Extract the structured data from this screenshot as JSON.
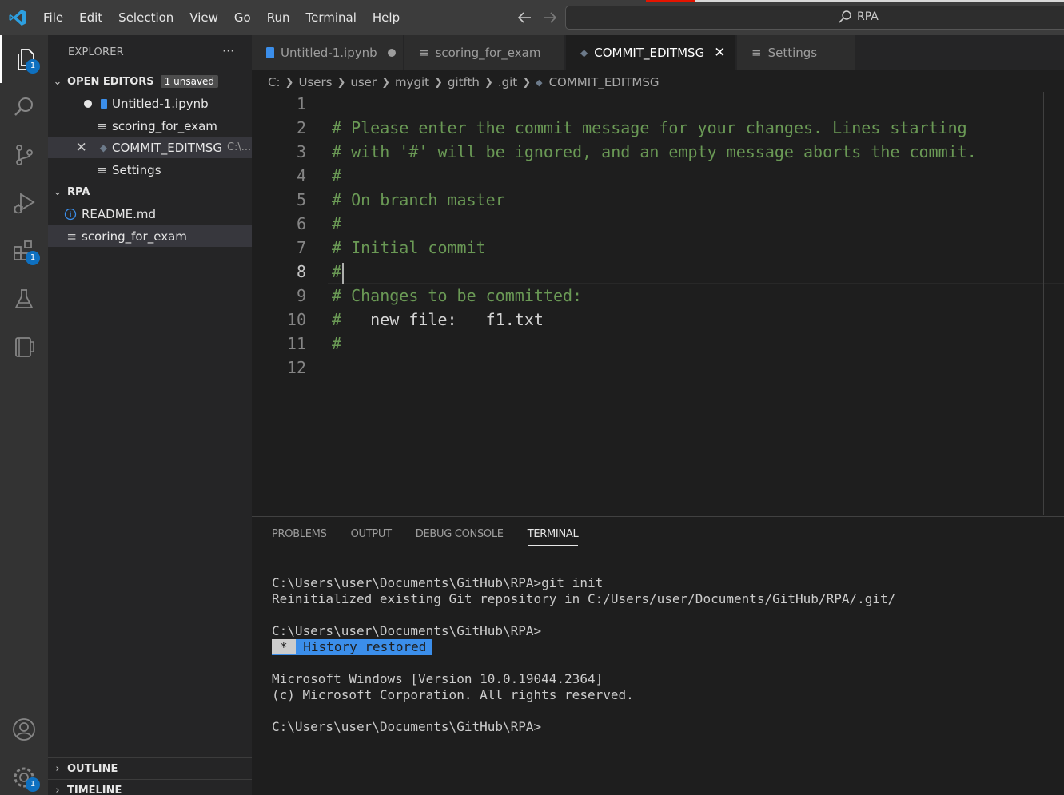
{
  "menu": [
    "File",
    "Edit",
    "Selection",
    "View",
    "Go",
    "Run",
    "Terminal",
    "Help"
  ],
  "search": {
    "label": "RPA"
  },
  "activity": {
    "explorer_badge": "1",
    "extensions_badge": "1",
    "settings_badge": "1"
  },
  "sidebar": {
    "title": "EXPLORER",
    "more": "···",
    "open_editors": {
      "label": "OPEN EDITORS",
      "badge": "1 unsaved",
      "items": [
        {
          "name": "Untitled-1.ipynb"
        },
        {
          "name": "scoring_for_exam"
        },
        {
          "name": "COMMIT_EDITMSG",
          "path": "C:\\..."
        },
        {
          "name": "Settings"
        }
      ]
    },
    "folder": {
      "label": "RPA",
      "items": [
        {
          "name": "README.md"
        },
        {
          "name": "scoring_for_exam"
        }
      ]
    },
    "outline": "OUTLINE",
    "timeline": "TIMELINE"
  },
  "tabs": [
    {
      "label": "Untitled-1.ipynb"
    },
    {
      "label": "scoring_for_exam"
    },
    {
      "label": "COMMIT_EDITMSG"
    },
    {
      "label": "Settings"
    }
  ],
  "breadcrumb": [
    "C:",
    "Users",
    "user",
    "mygit",
    "gitfth",
    ".git",
    "COMMIT_EDITMSG"
  ],
  "editor": {
    "current_line": 8,
    "lines": [
      {
        "n": "1",
        "text": ""
      },
      {
        "n": "2",
        "text": "# Please enter the commit message for your changes. Lines starting"
      },
      {
        "n": "3",
        "text": "# with '#' will be ignored, and an empty message aborts the commit."
      },
      {
        "n": "4",
        "text": "#"
      },
      {
        "n": "5",
        "text": "# On branch master"
      },
      {
        "n": "6",
        "text": "#"
      },
      {
        "n": "7",
        "text": "# Initial commit"
      },
      {
        "n": "8",
        "text": "#"
      },
      {
        "n": "9",
        "text": "# Changes to be committed:"
      },
      {
        "n": "10",
        "text": "#",
        "rest": "\tnew file:   f1.txt"
      },
      {
        "n": "11",
        "text": "#"
      },
      {
        "n": "12",
        "text": ""
      }
    ]
  },
  "panel": {
    "tabs": [
      "PROBLEMS",
      "OUTPUT",
      "DEBUG CONSOLE",
      "TERMINAL"
    ],
    "active_tab": "TERMINAL",
    "terminal": {
      "l1": "C:\\Users\\user\\Documents\\GitHub\\RPA>git init",
      "l2": "Reinitialized existing Git repository in C:/Users/user/Documents/GitHub/RPA/.git/",
      "l3": "C:\\Users\\user\\Documents\\GitHub\\RPA>",
      "hist_star": "*",
      "hist_text": "History restored",
      "l5": "Microsoft Windows [Version 10.0.19044.2364]",
      "l6": "(c) Microsoft Corporation. All rights reserved.",
      "l7": "C:\\Users\\user\\Documents\\GitHub\\RPA>"
    }
  }
}
